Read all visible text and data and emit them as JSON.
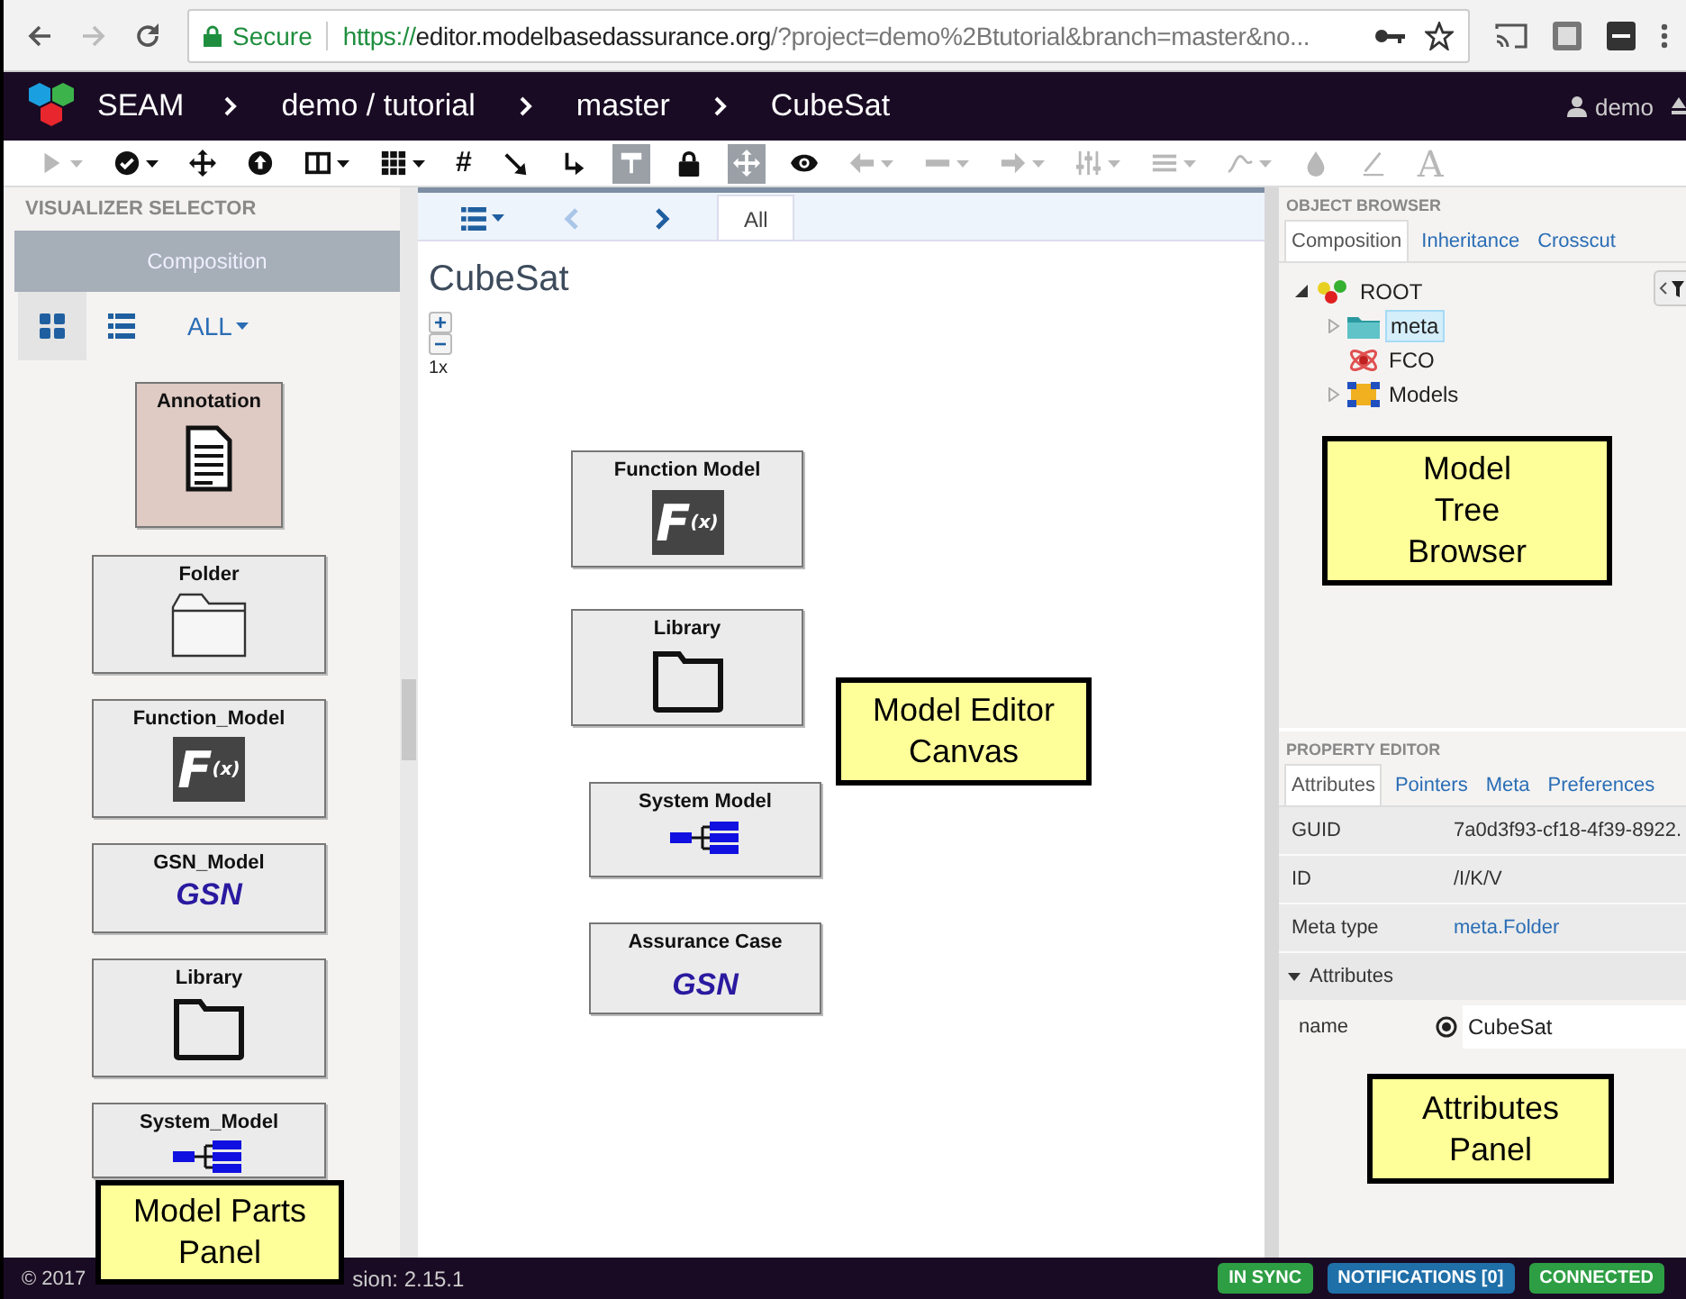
{
  "browser": {
    "secure_label": "Secure",
    "url_scheme": "https://",
    "url_host": "editor.modelbasedassurance.org",
    "url_rest": "/?project=demo%2Btutorial&branch=master&no..."
  },
  "navbar": {
    "app_name": "SEAM",
    "breadcrumbs": [
      "demo / tutorial",
      "master",
      "CubeSat"
    ],
    "user": "demo"
  },
  "toolbar": [
    {
      "kind": "play",
      "caret": true,
      "disabled": true,
      "selected": false
    },
    {
      "kind": "check",
      "caret": true,
      "disabled": false,
      "selected": false
    },
    {
      "kind": "move",
      "caret": false,
      "disabled": false,
      "selected": false
    },
    {
      "kind": "up",
      "caret": false,
      "disabled": false,
      "selected": false
    },
    {
      "kind": "columns",
      "caret": true,
      "disabled": false,
      "selected": false
    },
    {
      "kind": "grid",
      "caret": true,
      "disabled": false,
      "selected": false
    },
    {
      "kind": "text",
      "label": "#",
      "caret": false,
      "disabled": false,
      "selected": false
    },
    {
      "kind": "diagonal",
      "caret": false,
      "disabled": false,
      "selected": false
    },
    {
      "kind": "elbow",
      "caret": false,
      "disabled": false,
      "selected": false
    },
    {
      "kind": "tree",
      "caret": false,
      "disabled": false,
      "selected": true
    },
    {
      "kind": "lock",
      "caret": false,
      "disabled": false,
      "selected": false
    },
    {
      "kind": "move",
      "caret": false,
      "disabled": false,
      "selected": true
    },
    {
      "kind": "eye",
      "caret": false,
      "disabled": false,
      "selected": false
    },
    {
      "kind": "left",
      "caret": true,
      "disabled": true,
      "selected": false
    },
    {
      "kind": "dash",
      "caret": true,
      "disabled": true,
      "selected": false
    },
    {
      "kind": "right",
      "caret": true,
      "disabled": true,
      "selected": false
    },
    {
      "kind": "sliders",
      "caret": true,
      "disabled": true,
      "selected": false
    },
    {
      "kind": "lines",
      "caret": true,
      "disabled": true,
      "selected": false
    },
    {
      "kind": "curve",
      "caret": true,
      "disabled": true,
      "selected": false
    },
    {
      "kind": "drop",
      "caret": false,
      "disabled": true,
      "selected": false
    },
    {
      "kind": "pen",
      "caret": false,
      "disabled": true,
      "selected": false
    },
    {
      "kind": "text",
      "label": "A",
      "caret": false,
      "disabled": true,
      "selected": false
    }
  ],
  "visualizer_selector": {
    "title": "VISUALIZER SELECTOR",
    "visualizers": [
      {
        "label": "Composition",
        "selected": true
      }
    ],
    "views": [
      {
        "kind": "grid",
        "selected": true
      },
      {
        "kind": "list",
        "selected": false
      }
    ],
    "filter": "ALL"
  },
  "parts": [
    {
      "name": "Annotation",
      "kind": "annotation",
      "selected": true
    },
    {
      "name": "Folder",
      "kind": "folder",
      "selected": false
    },
    {
      "name": "Function_Model",
      "kind": "function",
      "icon_text": "F",
      "icon_sub": "(x)",
      "selected": false
    },
    {
      "name": "GSN_Model",
      "kind": "gsn",
      "icon_text": "GSN",
      "selected": false
    },
    {
      "name": "Library",
      "kind": "library",
      "selected": false
    },
    {
      "name": "System_Model",
      "kind": "system",
      "selected": false
    }
  ],
  "editor": {
    "tabs": [
      {
        "label": "All",
        "selected": true
      }
    ],
    "back_disabled": true,
    "title": "CubeSat",
    "zoom_plus": "+",
    "zoom_minus": "−",
    "zoom_level": "1x",
    "nodes": [
      {
        "name": "Function Model",
        "kind": "function",
        "icon_text": "F",
        "icon_sub": "(x)"
      },
      {
        "name": "Library",
        "kind": "library"
      },
      {
        "name": "System Model",
        "kind": "system"
      },
      {
        "name": "Assurance Case",
        "kind": "gsn",
        "icon_text": "GSN"
      }
    ]
  },
  "object_browser": {
    "title": "OBJECT BROWSER",
    "tabs": [
      {
        "label": "Composition",
        "selected": true
      },
      {
        "label": "Inheritance",
        "selected": false
      },
      {
        "label": "Crosscut",
        "selected": false
      }
    ],
    "tree": [
      {
        "label": "ROOT",
        "kind": "root",
        "expanded": true,
        "selected": false,
        "children": [
          {
            "label": "meta",
            "kind": "folder",
            "expanded": false,
            "selected": true
          },
          {
            "label": "FCO",
            "kind": "fco",
            "selected": false
          },
          {
            "label": "Models",
            "kind": "models",
            "expanded": false,
            "selected": false
          }
        ]
      }
    ]
  },
  "property_editor": {
    "title": "PROPERTY EDITOR",
    "tabs": [
      {
        "label": "Attributes",
        "selected": true
      },
      {
        "label": "Pointers",
        "selected": false
      },
      {
        "label": "Meta",
        "selected": false
      },
      {
        "label": "Preferences",
        "selected": false
      }
    ],
    "rows": [
      {
        "label": "GUID",
        "value": "7a0d3f93-cf18-4f39-8922.",
        "kind": "text"
      },
      {
        "label": "ID",
        "value": "/I/K/V",
        "kind": "text"
      },
      {
        "label": "Meta type",
        "value": "meta.Folder",
        "kind": "link"
      }
    ],
    "section": {
      "label": "Attributes",
      "expanded": true
    },
    "attributes": [
      {
        "name": "name",
        "value": "CubeSat"
      }
    ]
  },
  "status_bar": {
    "copyright": "© 2017",
    "version": "sion: 2.15.1",
    "badges": [
      {
        "label": "IN SYNC",
        "color": "#2e9e44"
      },
      {
        "label": "NOTIFICATIONS [0]",
        "color": "#1f6fa8"
      },
      {
        "label": "CONNECTED",
        "color": "#2e9e44"
      }
    ]
  },
  "callouts": [
    {
      "lines": [
        "Model Parts",
        "Panel"
      ]
    },
    {
      "lines": [
        "Model Editor",
        "Canvas"
      ]
    },
    {
      "lines": [
        "Model",
        "Tree",
        "Browser"
      ]
    },
    {
      "lines": [
        "Attributes",
        "Panel"
      ]
    }
  ]
}
